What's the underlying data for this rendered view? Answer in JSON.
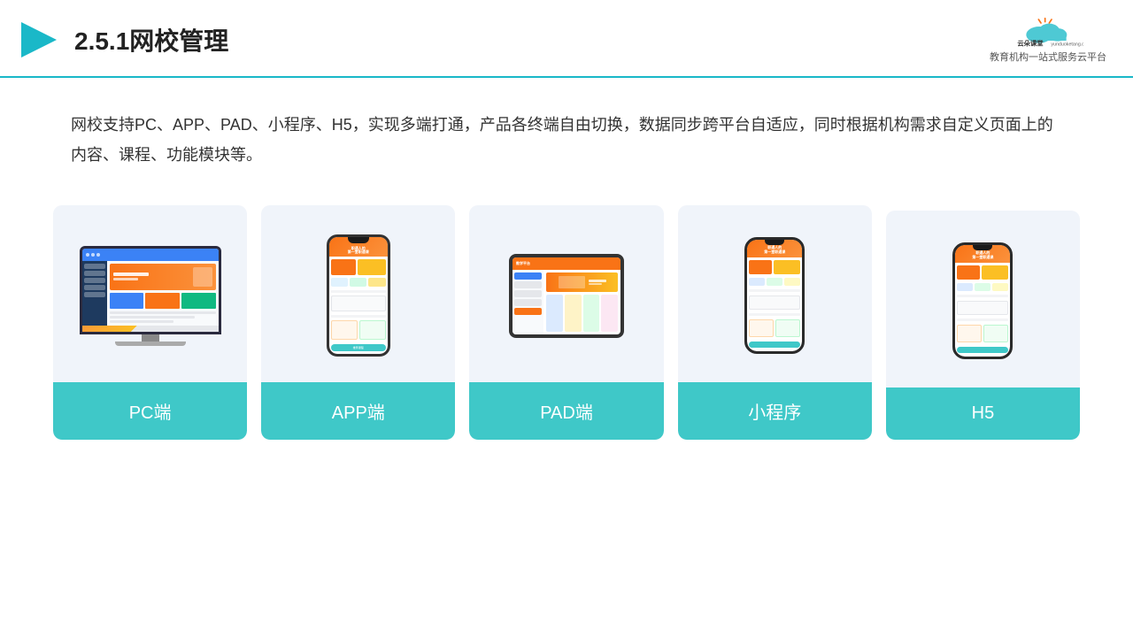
{
  "header": {
    "title": "2.5.1网校管理",
    "logo_url_text": "yunduoketang.com",
    "logo_subtitle": "教育机构一站\n式服务云平台"
  },
  "description": {
    "text": "网校支持PC、APP、PAD、小程序、H5，实现多端打通，产品各终端自由切换，数据同步跨平台自适应，同时根据机构需求自定义页面上的内容、课程、功能模块等。"
  },
  "devices": [
    {
      "id": "pc",
      "label": "PC端"
    },
    {
      "id": "app",
      "label": "APP端"
    },
    {
      "id": "pad",
      "label": "PAD端"
    },
    {
      "id": "miniprogram",
      "label": "小程序"
    },
    {
      "id": "h5",
      "label": "H5"
    }
  ],
  "accent_color": "#3fc8c8",
  "colors": {
    "card_bg": "#f0f4fa",
    "label_bg": "#3fc8c8",
    "label_text": "#ffffff"
  }
}
